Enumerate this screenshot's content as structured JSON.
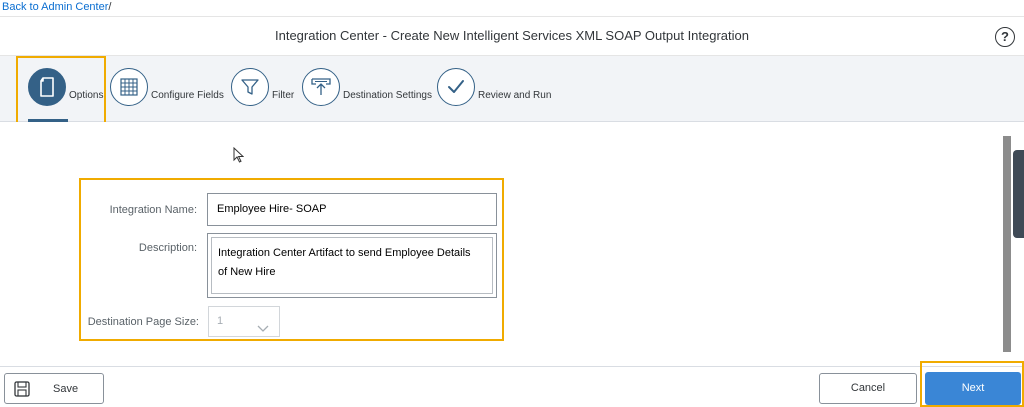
{
  "breadcrumb": {
    "link": "Back to Admin Center",
    "separator": "/"
  },
  "header": {
    "title": "Integration Center - Create New Intelligent Services XML SOAP Output Integration",
    "help_label": "?"
  },
  "wizard": {
    "steps": [
      {
        "label": "Options",
        "icon": "document-icon",
        "active": true
      },
      {
        "label": "Configure Fields",
        "icon": "table-grid-icon",
        "active": false
      },
      {
        "label": "Filter",
        "icon": "funnel-filter-icon",
        "active": false
      },
      {
        "label": "Destination Settings",
        "icon": "upload-tray-icon",
        "active": false
      },
      {
        "label": "Review and Run",
        "icon": "checkmark-icon",
        "active": false
      }
    ]
  },
  "form": {
    "integration_name_label": "Integration Name:",
    "integration_name_value": "Employee Hire- SOAP",
    "description_label": "Description:",
    "description_line1": "Integration Center Artifact to send Employee Details",
    "description_line2": "of New Hire",
    "page_size_label": "Destination Page Size:",
    "page_size_value": "1"
  },
  "footer": {
    "save_label": "Save",
    "cancel_label": "Cancel",
    "next_label": "Next"
  },
  "colors": {
    "accent": "#346187",
    "highlight": "#f0ab00",
    "primary_button": "#3a86d6",
    "link": "#0a6ed1"
  }
}
